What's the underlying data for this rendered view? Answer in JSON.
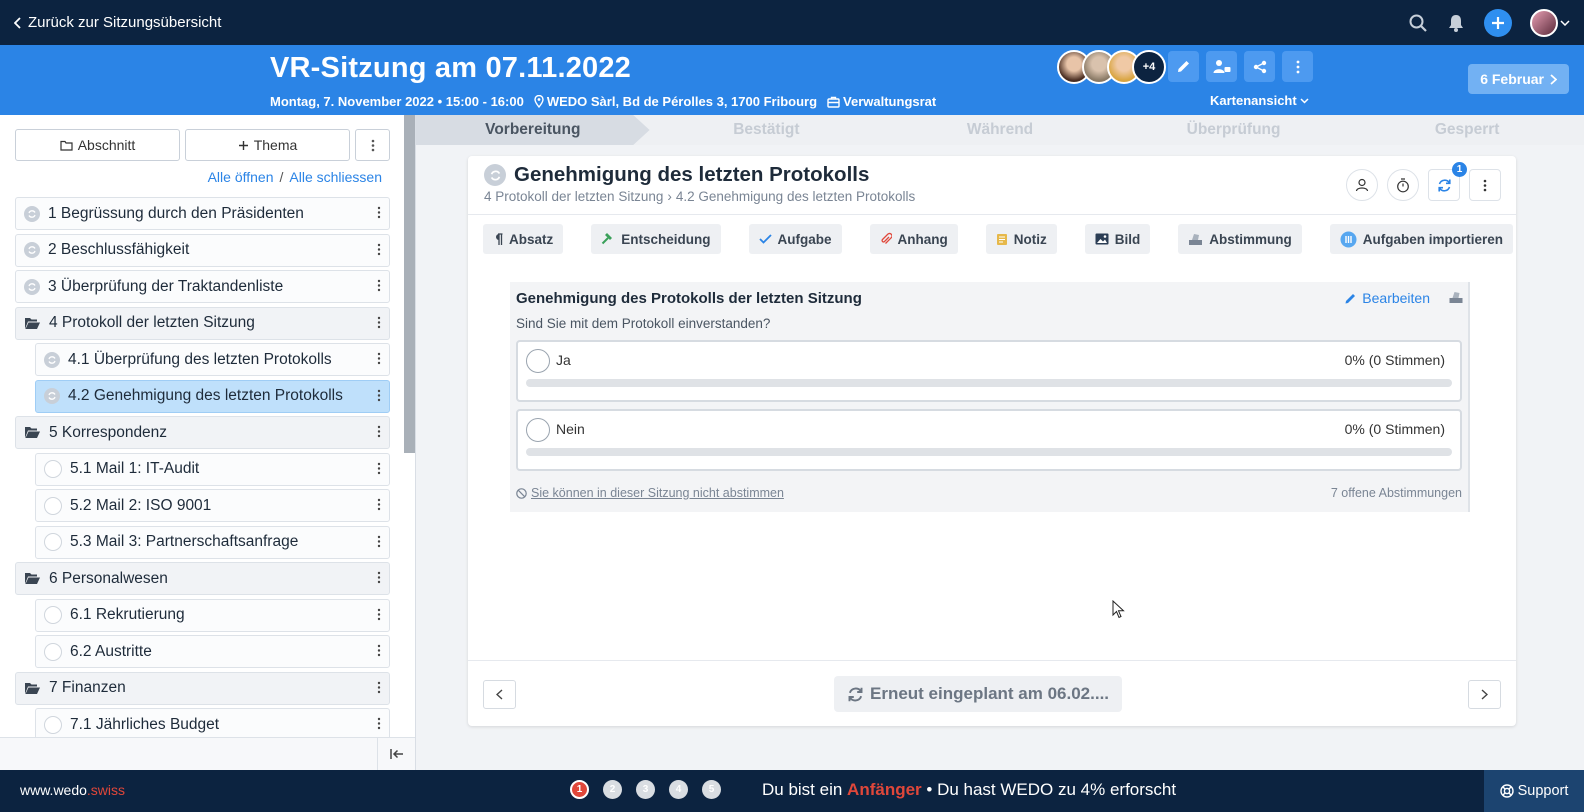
{
  "topbar": {
    "back_label": "Zurück zur Sitzungsübersicht"
  },
  "header": {
    "title": "VR-Sitzung am 07.11.2022",
    "date_time": "Montag, 7. November 2022 • 15:00 - 16:00",
    "location": "WEDO Sàrl, Bd de Pérolles 3, 1700 Fribourg",
    "board": "Verwaltungsrat",
    "more_participants": "+4",
    "view_mode": "Kartenansicht",
    "next_meeting": "6 Februar"
  },
  "sidebar": {
    "section_button": "Abschnitt",
    "topic_button": "Thema",
    "open_all": "Alle öffnen",
    "separator": "/",
    "close_all": "Alle schliessen",
    "items": [
      {
        "label": "1 Begrüssung durch den Präsidenten"
      },
      {
        "label": "2 Beschlussfähigkeit"
      },
      {
        "label": "3 Überprüfung der Traktandenliste"
      },
      {
        "label": "4 Protokoll der letzten Sitzung"
      },
      {
        "label": "4.1 Überprüfung des letzten Protokolls"
      },
      {
        "label": "4.2 Genehmigung des letzten Protokolls"
      },
      {
        "label": "5 Korrespondenz"
      },
      {
        "label": "5.1 Mail 1: IT-Audit"
      },
      {
        "label": "5.2 Mail 2: ISO 9001"
      },
      {
        "label": "5.3 Mail 3: Partnerschaftsanfrage"
      },
      {
        "label": "6 Personalwesen"
      },
      {
        "label": "6.1 Rekrutierung"
      },
      {
        "label": "6.2 Austritte"
      },
      {
        "label": "7 Finanzen"
      },
      {
        "label": "7.1 Jährliches Budget"
      }
    ]
  },
  "stepper": [
    "Vorbereitung",
    "Bestätigt",
    "Während",
    "Überprüfung",
    "Gesperrt"
  ],
  "topic": {
    "title": "Genehmigung des letzten Protokolls",
    "crumb_parent": "4 Protokoll der letzten Sitzung",
    "crumb_current": "4.2 Genehmigung des letzten Protokolls",
    "sync_badge": "1"
  },
  "insert": [
    "Absatz",
    "Entscheidung",
    "Aufgabe",
    "Anhang",
    "Notiz",
    "Bild",
    "Abstimmung",
    "Aufgaben importieren"
  ],
  "vote": {
    "title": "Genehmigung des Protokolls der letzten Sitzung",
    "edit": "Bearbeiten",
    "question": "Sind Sie mit dem Protokoll einverstanden?",
    "options": [
      {
        "label": "Ja",
        "result": "0% (0 Stimmen)",
        "share": 0
      },
      {
        "label": "Nein",
        "result": "0% (0 Stimmen)",
        "share": 0
      }
    ],
    "cannot_vote": "Sie können in dieser Sitzung nicht abstimmen",
    "open_votes": "7 offene Abstimmungen"
  },
  "footer": {
    "rescheduled": "Erneut eingeplant am 06.02...."
  },
  "bottombar": {
    "brand_prefix": "www.wedo",
    "brand_suffix": ".swiss",
    "levels": [
      "1",
      "2",
      "3",
      "4",
      "5"
    ],
    "progress_before": "Du bist ein ",
    "progress_level": "Anfänger",
    "progress_after": " • Du hast WEDO zu 4% erforscht",
    "support": "Support"
  }
}
